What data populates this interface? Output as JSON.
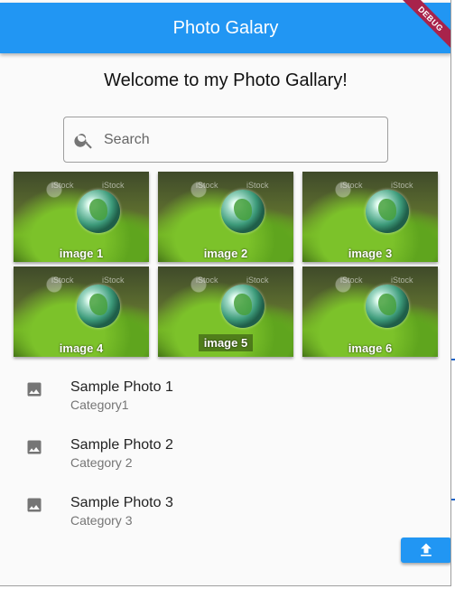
{
  "appbar": {
    "title": "Photo Galary",
    "debug_label": "DEBUG"
  },
  "welcome": "Welcome to my Photo Gallary!",
  "search": {
    "placeholder": "Search",
    "value": ""
  },
  "gallery": [
    {
      "caption": "image 1",
      "watermark": "iStock"
    },
    {
      "caption": "image 2",
      "watermark": "iStock"
    },
    {
      "caption": "image 3",
      "watermark": "iStock"
    },
    {
      "caption": "image 4",
      "watermark": "iStock"
    },
    {
      "caption": "image 5",
      "watermark": "iStock"
    },
    {
      "caption": "image 6",
      "watermark": "iStock"
    }
  ],
  "photos": [
    {
      "title": "Sample Photo 1",
      "category": "Category1"
    },
    {
      "title": "Sample Photo 2",
      "category": "Category 2"
    },
    {
      "title": "Sample Photo 3",
      "category": "Category 3"
    }
  ],
  "colors": {
    "primary": "#2196f3",
    "debug": "#a8234b"
  },
  "icons": {
    "search": "search-icon",
    "list_item": "image-icon",
    "fab": "upload-icon"
  }
}
